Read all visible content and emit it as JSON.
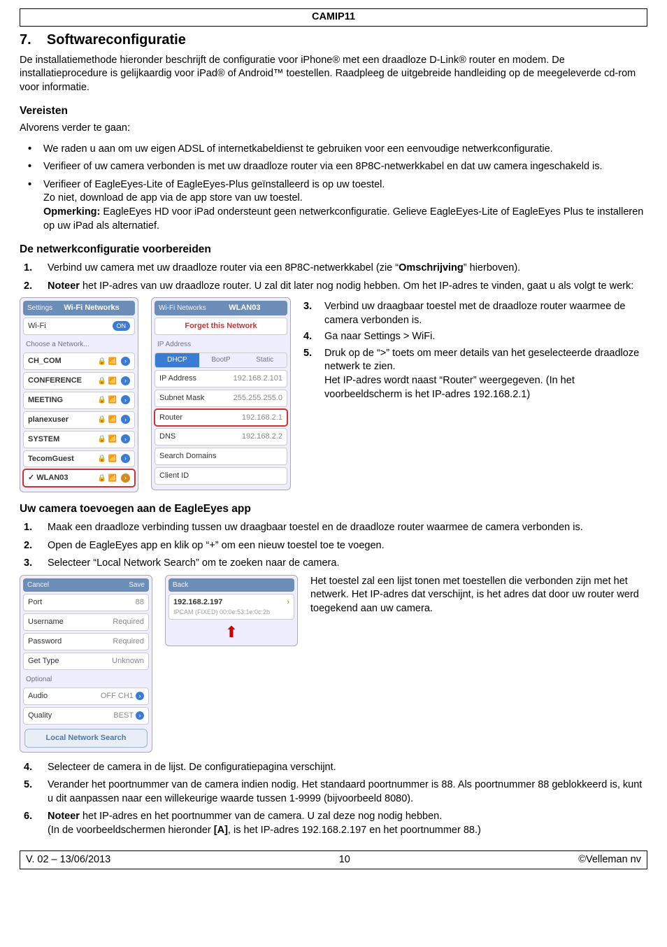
{
  "header": "CAMIP11",
  "section_no": "7.",
  "section_title": "Softwareconfiguratie",
  "intro": "De installatiemethode hieronder beschrijft de configuratie voor iPhone® met een draadloze D-Link® router en modem. De installatieprocedure is gelijkaardig voor iPad® of Android™ toestellen. Raadpleeg de uitgebreide handleiding op de meegeleverde cd-rom voor informatie.",
  "sub1": "Vereisten",
  "sub1_lead": "Alvorens verder te gaan:",
  "bul": [
    "We raden u aan om uw eigen ADSL of internetkabeldienst te gebruiken voor een eenvoudige netwerkconfiguratie.",
    "Verifieer of uw camera verbonden is met uw draadloze router via een 8P8C-netwerkkabel en dat uw camera ingeschakeld is.",
    "Verifieer of EagleEyes-Lite of EagleEyes-Plus geïnstalleerd is op uw toestel.\nZo niet, download de app via de app store van uw toestel.\n"
  ],
  "bul3_note_label": "Opmerking:",
  "bul3_note": " EagleEyes HD voor iPad ondersteunt geen netwerkconfiguratie. Gelieve EagleEyes-Lite of EagleEyes Plus te installeren op uw iPad als alternatief.",
  "sub2": "De netwerkconfiguratie voorbereiden",
  "num2": [
    "Verbind uw camera met uw draadloze router via een 8P8C-netwerkkabel (zie “Omschrijving” hierboven).",
    "Noteer het IP-adres van uw draadloze router. U zal dit later nog nodig hebben. Om het IP-adres te vinden, gaat u als volgt te werk:"
  ],
  "num2_1_bold": "Omschrijving",
  "num2_2_bold": "Noteer",
  "side_steps": [
    {
      "n": "3.",
      "t": "Verbind uw draagbaar toestel met de draadloze router waarmee de camera verbonden is."
    },
    {
      "n": "4.",
      "t": "Ga naar Settings > WiFi."
    },
    {
      "n": "5.",
      "t": "Druk op de “>” toets om meer details van het geselecteerde draadloze netwerk te zien.\nHet IP-adres wordt naast “Router” weergegeven. (In het voorbeeldscherm is het IP-adres 192.168.2.1)"
    }
  ],
  "wifi_panel": {
    "back": "Settings",
    "title": "Wi-Fi Networks",
    "wifi": "Wi-Fi",
    "on": "ON",
    "choose": "Choose a Network...",
    "nets": [
      "CH_COM",
      "CONFERENCE",
      "MEETING",
      "planexuser",
      "SYSTEM",
      "TecomGuest",
      "✓ WLAN03"
    ]
  },
  "detail_panel": {
    "back": "Wi-Fi Networks",
    "title": "WLAN03",
    "forget": "Forget this Network",
    "ipaddr_sect": "IP Address",
    "tabs": [
      "DHCP",
      "BootP",
      "Static"
    ],
    "rows": [
      {
        "k": "IP Address",
        "v": "192.168.2.101"
      },
      {
        "k": "Subnet Mask",
        "v": "255.255.255.0"
      },
      {
        "k": "Router",
        "v": "192.168.2.1",
        "hl": true
      },
      {
        "k": "DNS",
        "v": "192.168.2.2"
      }
    ],
    "search": "Search Domains",
    "client": "Client ID"
  },
  "sub3": "Uw camera toevoegen aan de EagleEyes app",
  "num3": [
    "Maak een draadloze verbinding tussen uw draagbaar toestel en de draadloze router waarmee de camera verbonden is.",
    "Open de EagleEyes app en klik op “+” om een nieuw toestel toe te voegen.",
    "Selecteer “Local Network Search” om te zoeken naar de camera."
  ],
  "form_panel": {
    "cancel": "Cancel",
    "save": "Save",
    "rows": [
      {
        "k": "Port",
        "v": "88"
      },
      {
        "k": "Username",
        "v": "Required"
      },
      {
        "k": "Password",
        "v": "Required"
      }
    ],
    "gettype": "Get Type",
    "gettype_v": "Unknown",
    "optional": "Optional",
    "audio": "Audio",
    "audio_v1": "OFF",
    "audio_v2": "CH1",
    "quality": "Quality",
    "quality_v": "BEST",
    "search": "Local Network Search"
  },
  "dev_panel": {
    "back": "Back",
    "ip": "192.168.2.197",
    "mac": "IPCAM (FIXED)  00:0e:53:1e:0c:2b"
  },
  "side_text3": "Het toestel zal een lijst tonen met toestellen die verbonden zijn met het netwerk. Het IP-adres dat verschijnt, is het adres dat door uw router werd toegekend aan uw camera.",
  "num3b": [
    "Selecteer de camera in de lijst. De configuratiepagina verschijnt.",
    "Verander het poortnummer van de camera indien nodig. Het standaard poortnummer is 88. Als poortnummer 88 geblokkeerd is, kunt u dit aanpassen naar een willekeurige waarde tussen 1-9999 (bijvoorbeeld 8080).",
    "Noteer het IP-adres en het poortnummer van de camera. U zal deze nog nodig hebben.\n(In de voorbeeldschermen hieronder [A], is het IP-adres 192.168.2.197 en het poortnummer 88.)"
  ],
  "num3b_6_bold": "Noteer",
  "num3b_6_bracket": "[A]",
  "footer": {
    "left": "V. 02 – 13/06/2013",
    "mid": "10",
    "right": "©Velleman nv"
  }
}
